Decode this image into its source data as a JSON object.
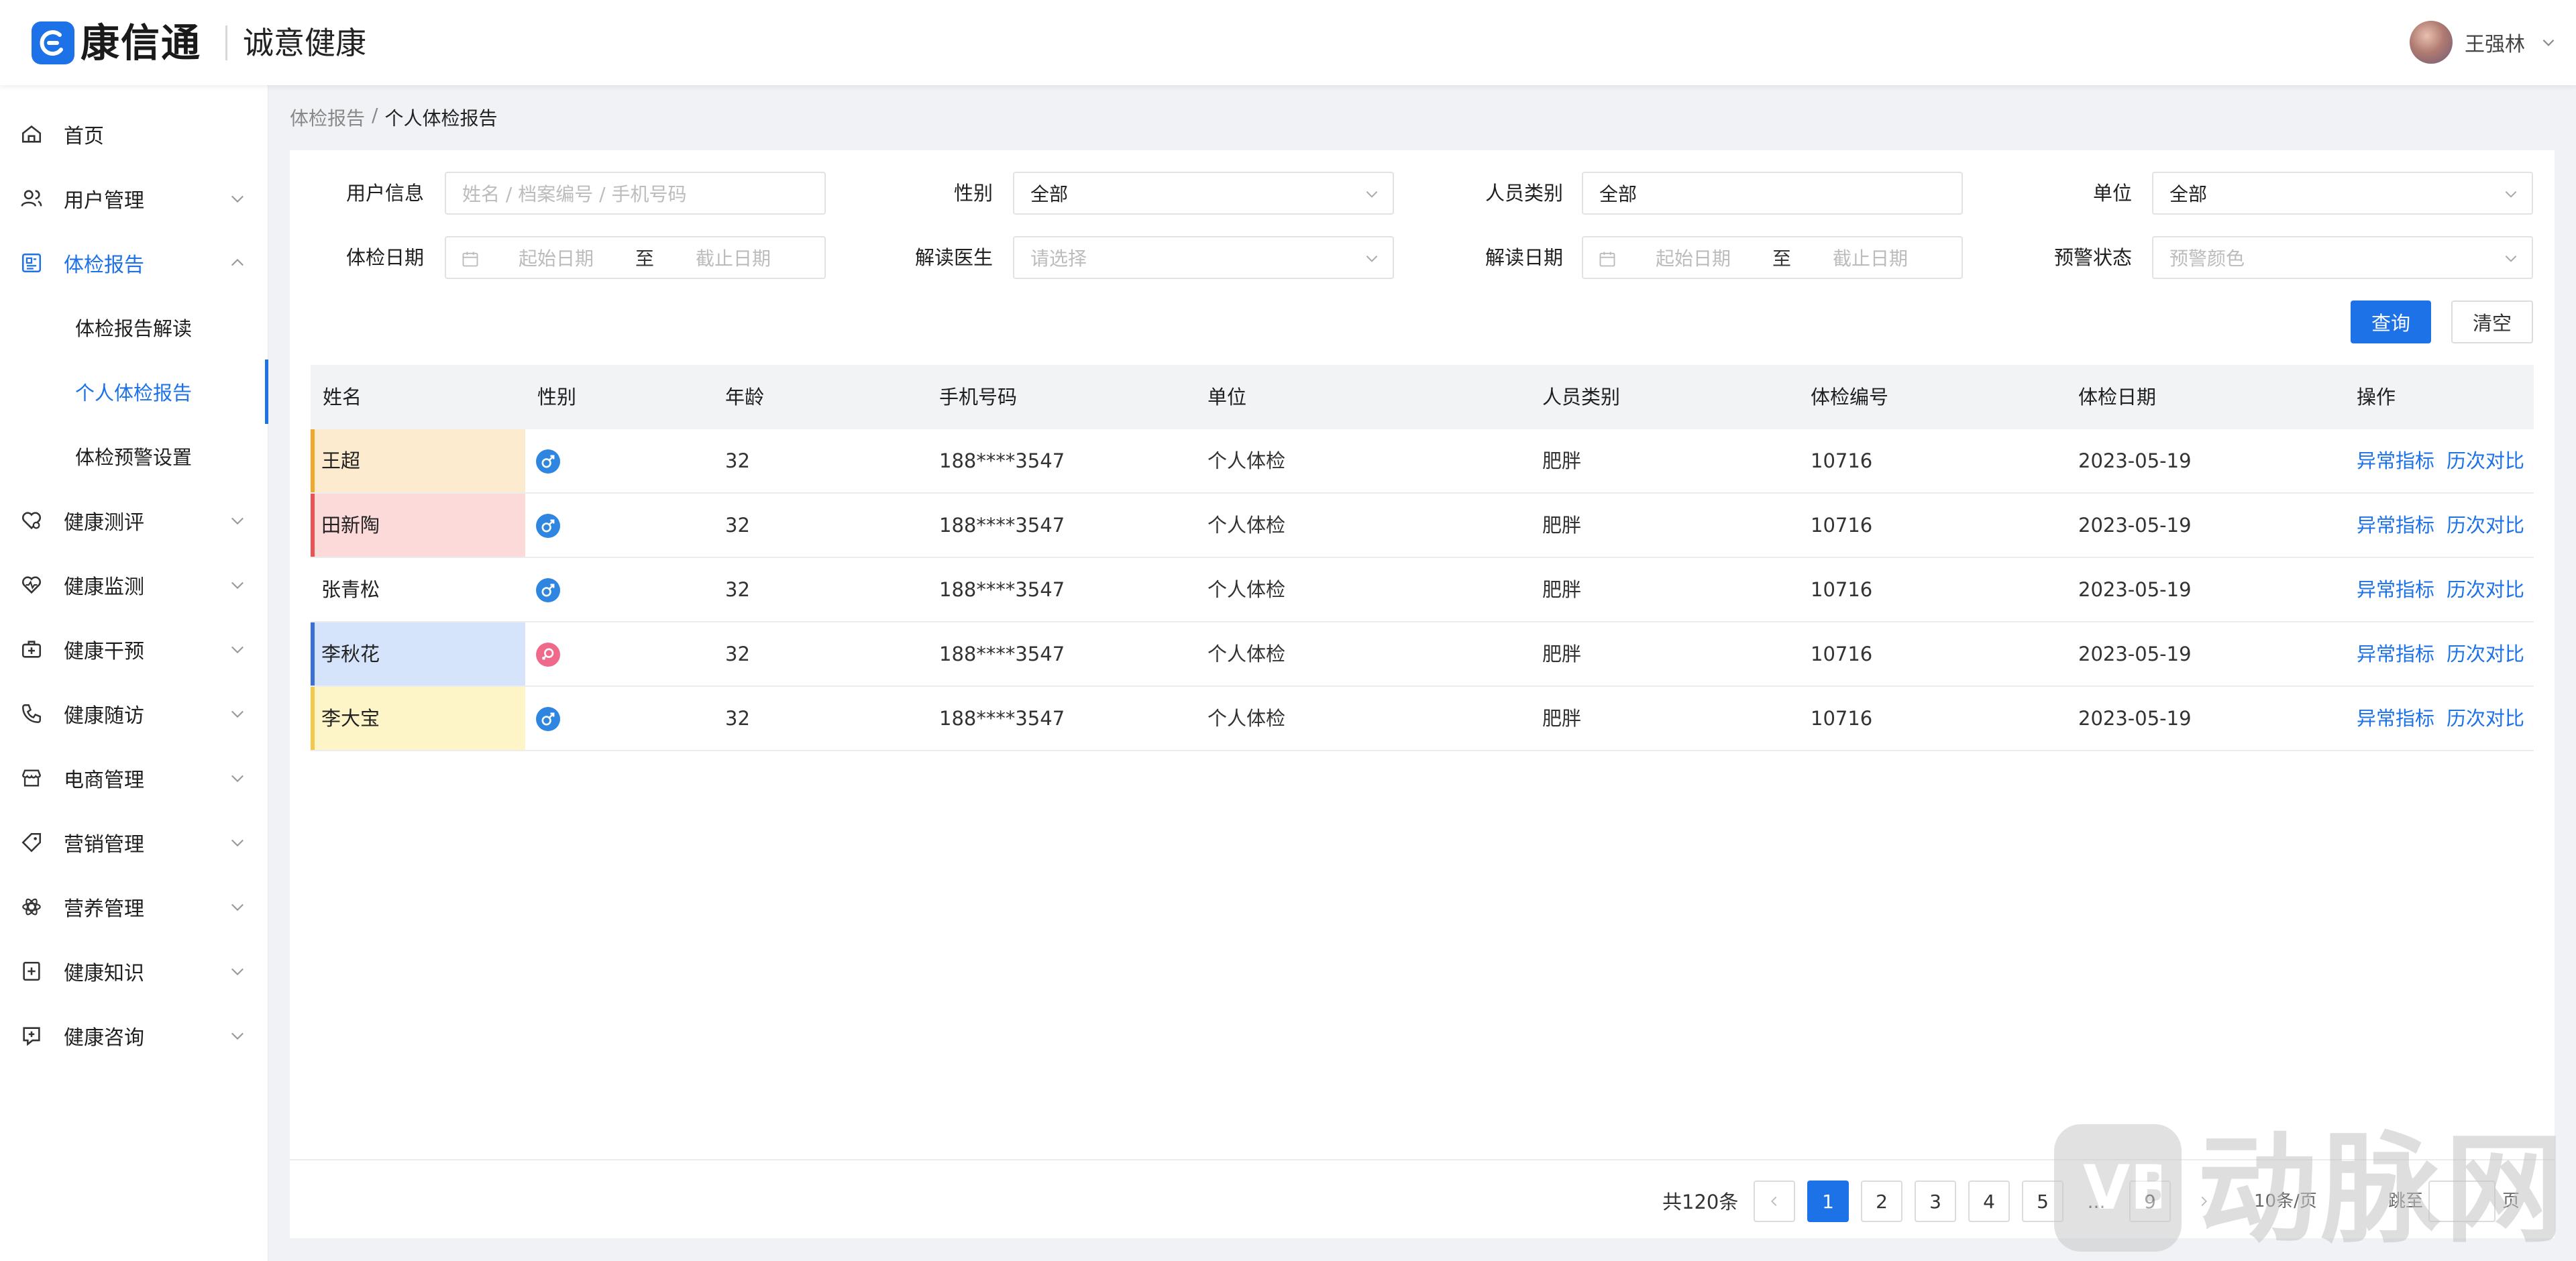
{
  "header": {
    "brand": "康信通",
    "org": "诚意健康",
    "user_name": "王强林"
  },
  "sidebar": {
    "items": [
      {
        "label": "首页",
        "icon": "home-icon",
        "expandable": false
      },
      {
        "label": "用户管理",
        "icon": "users-icon",
        "expandable": true
      },
      {
        "label": "体检报告",
        "icon": "report-icon",
        "expandable": true,
        "expanded": true
      },
      {
        "label": "健康测评",
        "icon": "heart-check-icon",
        "expandable": true
      },
      {
        "label": "健康监测",
        "icon": "heartbeat-icon",
        "expandable": true
      },
      {
        "label": "健康干预",
        "icon": "medkit-icon",
        "expandable": true
      },
      {
        "label": "健康随访",
        "icon": "phone-icon",
        "expandable": true
      },
      {
        "label": "电商管理",
        "icon": "shop-icon",
        "expandable": true
      },
      {
        "label": "营销管理",
        "icon": "tag-icon",
        "expandable": true
      },
      {
        "label": "营养管理",
        "icon": "nutrition-icon",
        "expandable": true
      },
      {
        "label": "健康知识",
        "icon": "book-plus-icon",
        "expandable": true
      },
      {
        "label": "健康咨询",
        "icon": "consult-icon",
        "expandable": true
      }
    ],
    "sub_items": [
      {
        "label": "体检报告解读",
        "selected": false
      },
      {
        "label": "个人体检报告",
        "selected": true
      },
      {
        "label": "体检预警设置",
        "selected": false
      }
    ]
  },
  "breadcrumb": {
    "parent": "体检报告",
    "separator": "/",
    "current": "个人体检报告"
  },
  "filters": {
    "user_info": {
      "label": "用户信息",
      "placeholder": "姓名 / 档案编号 / 手机号码"
    },
    "gender": {
      "label": "性别",
      "value": "全部"
    },
    "person_type": {
      "label": "人员类别",
      "value": "全部"
    },
    "unit": {
      "label": "单位",
      "value": "全部"
    },
    "exam_date": {
      "label": "体检日期",
      "start_placeholder": "起始日期",
      "separator": "至",
      "end_placeholder": "截止日期"
    },
    "doctor": {
      "label": "解读医生",
      "placeholder": "请选择"
    },
    "read_date": {
      "label": "解读日期",
      "start_placeholder": "起始日期",
      "separator": "至",
      "end_placeholder": "截止日期"
    },
    "alert_status": {
      "label": "预警状态",
      "placeholder": "预警颜色"
    },
    "query_button": "查询",
    "clear_button": "清空"
  },
  "table": {
    "columns": [
      "姓名",
      "性别",
      "年龄",
      "手机号码",
      "单位",
      "人员类别",
      "体检编号",
      "体检日期",
      "操作"
    ],
    "rows": [
      {
        "name": "王超",
        "gender": "male",
        "age": "32",
        "phone": "188****3547",
        "unit": "个人体检",
        "type": "肥胖",
        "exam_no": "10716",
        "date": "2023-05-19",
        "alert_color": "#fdebd0",
        "alert_border": "#f0a830"
      },
      {
        "name": "田新陶",
        "gender": "male",
        "age": "32",
        "phone": "188****3547",
        "unit": "个人体检",
        "type": "肥胖",
        "exam_no": "10716",
        "date": "2023-05-19",
        "alert_color": "#fddada",
        "alert_border": "#e85454"
      },
      {
        "name": "张青松",
        "gender": "male",
        "age": "32",
        "phone": "188****3547",
        "unit": "个人体检",
        "type": "肥胖",
        "exam_no": "10716",
        "date": "2023-05-19",
        "alert_color": "#ffffff",
        "alert_border": "#ffffff"
      },
      {
        "name": "李秋花",
        "gender": "female",
        "age": "32",
        "phone": "188****3547",
        "unit": "个人体检",
        "type": "肥胖",
        "exam_no": "10716",
        "date": "2023-05-19",
        "alert_color": "#d6e4fb",
        "alert_border": "#3a6fd8"
      },
      {
        "name": "李大宝",
        "gender": "male",
        "age": "32",
        "phone": "188****3547",
        "unit": "个人体检",
        "type": "肥胖",
        "exam_no": "10716",
        "date": "2023-05-19",
        "alert_color": "#fdf4c8",
        "alert_border": "#f2c94c"
      }
    ],
    "actions": {
      "abnormal": "异常指标",
      "history": "历次对比"
    }
  },
  "pagination": {
    "total": "共120条",
    "pages": [
      "1",
      "2",
      "3",
      "4",
      "5",
      "...",
      "9"
    ],
    "current": "1",
    "page_size": "10条/页",
    "jump_label": "跳至",
    "page_suffix": "页"
  },
  "watermark": {
    "mark": "VB",
    "text": "动脉网"
  },
  "colors": {
    "accent": "#1d72e8",
    "male_icon": "#2f86e0",
    "female_icon": "#ef6a8a"
  }
}
